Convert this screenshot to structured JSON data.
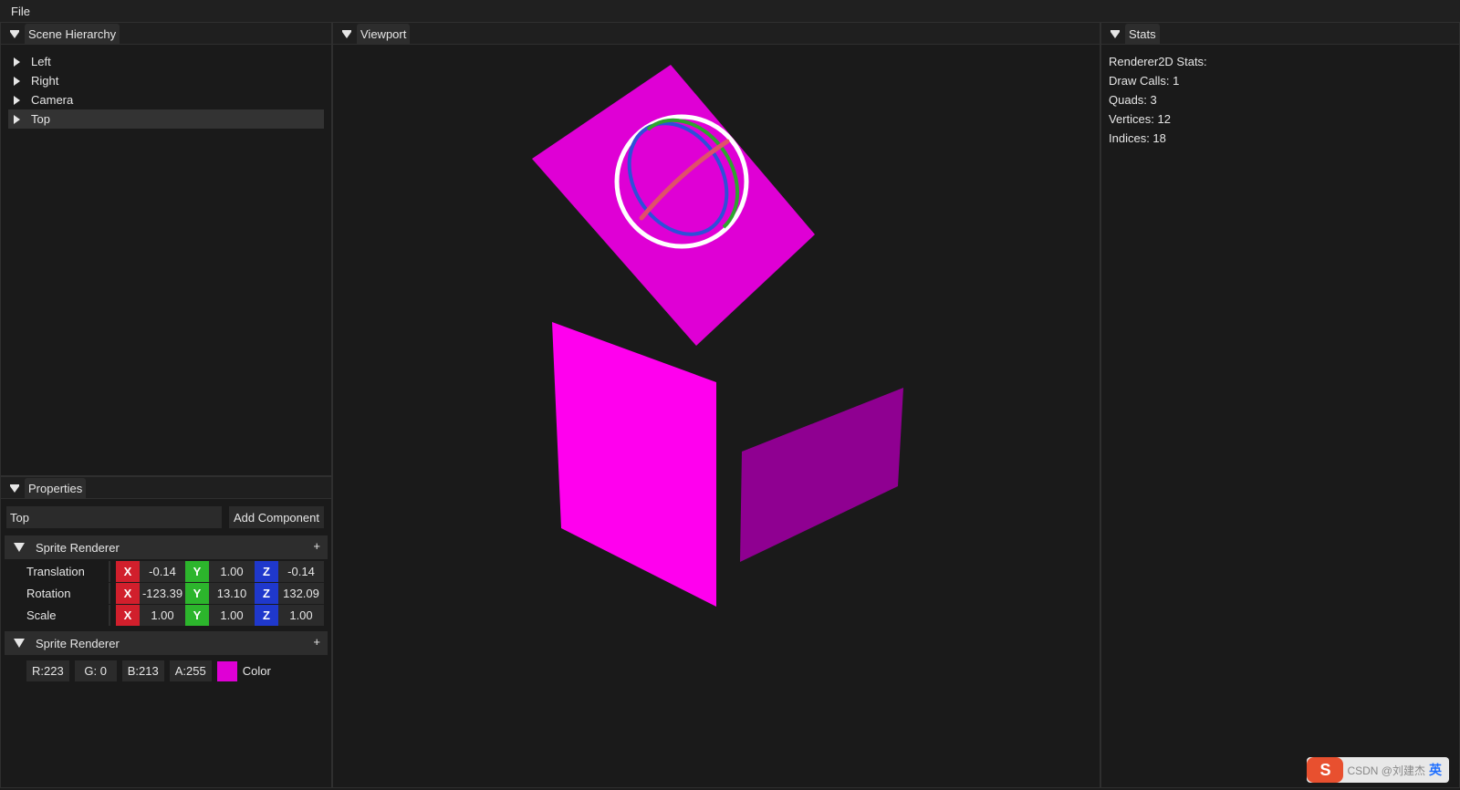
{
  "menu": {
    "file": "File"
  },
  "scene_hierarchy": {
    "title": "Scene Hierarchy",
    "items": [
      "Left",
      "Right",
      "Camera",
      "Top"
    ],
    "selected": "Top"
  },
  "properties": {
    "title": "Properties",
    "entity_name": "Top",
    "add_component": "Add Component",
    "transform": {
      "header": "Sprite Renderer",
      "plus": "+",
      "rows": [
        {
          "label": "Translation",
          "x": "-0.14",
          "y": "1.00",
          "z": "-0.14"
        },
        {
          "label": "Rotation",
          "x": "-123.39",
          "y": "13.10",
          "z": "132.09"
        },
        {
          "label": "Scale",
          "x": "1.00",
          "y": "1.00",
          "z": "1.00"
        }
      ],
      "axis_labels": {
        "x": "X",
        "y": "Y",
        "z": "Z"
      }
    },
    "sprite": {
      "header": "Sprite Renderer",
      "plus": "+",
      "r": "R:223",
      "g": "G:  0",
      "b": "B:213",
      "a": "A:255",
      "color_label": "Color",
      "swatch_color": "#df00d5"
    }
  },
  "viewport": {
    "title": "Viewport",
    "colors": {
      "top_quad": "#df00d5",
      "left_quad": "#ff00ee",
      "right_quad": "#8f0091",
      "gizmo_outer": "#ffffff",
      "gizmo_x": "#e0506a",
      "gizmo_y": "#2ea52e",
      "gizmo_z": "#2f4fd8"
    }
  },
  "stats": {
    "title": "Stats",
    "heading": "Renderer2D Stats:",
    "draw_calls": "Draw Calls: 1",
    "quads": "Quads: 3",
    "vertices": "Vertices: 12",
    "indices": "Indices: 18"
  },
  "watermark": {
    "logo": "S",
    "text": "CSDN @刘建杰",
    "ime": "英"
  }
}
